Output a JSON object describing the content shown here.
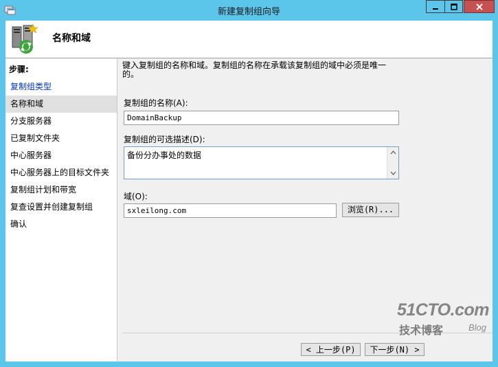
{
  "window": {
    "title": "新建复制组向导",
    "min_icon": "minimize-icon",
    "max_icon": "maximize-icon",
    "close_icon": "close-icon"
  },
  "header": {
    "title": "名称和域",
    "icon": "replication-servers-icon"
  },
  "sidebar": {
    "heading": "步骤:",
    "steps": [
      {
        "label": "复制组类型",
        "state": "link"
      },
      {
        "label": "名称和域",
        "state": "current"
      },
      {
        "label": "分支服务器",
        "state": "normal"
      },
      {
        "label": "已复制文件夹",
        "state": "normal"
      },
      {
        "label": "中心服务器",
        "state": "normal"
      },
      {
        "label": "中心服务器上的目标文件夹",
        "state": "normal"
      },
      {
        "label": "复制组计划和带宽",
        "state": "normal"
      },
      {
        "label": "复查设置并创建复制组",
        "state": "normal"
      },
      {
        "label": "确认",
        "state": "normal"
      }
    ]
  },
  "main": {
    "description_line1": "键入复制组的名称和域。复制组的名称在承载该复制组的域中必须是唯一",
    "description_line2": "的。",
    "name_label": "复制组的名称(A):",
    "name_value": "DomainBackup",
    "desc_label": "复制组的可选描述(D):",
    "desc_value": "备份分办事处的数据",
    "domain_label": "域(O):",
    "domain_value": "sxleilong.com",
    "browse_label": "浏览(R)..."
  },
  "footer": {
    "back_label": "< 上一步(P)",
    "next_label": "下一步(N) >"
  },
  "watermark": {
    "main": "51CTO.com",
    "sub": "技术博客",
    "blog": "Blog"
  },
  "colors": {
    "titlebar": "#5bc6ea",
    "close_button": "#c75050",
    "link": "#0033cc",
    "selected_step": "#e0e0e0"
  }
}
